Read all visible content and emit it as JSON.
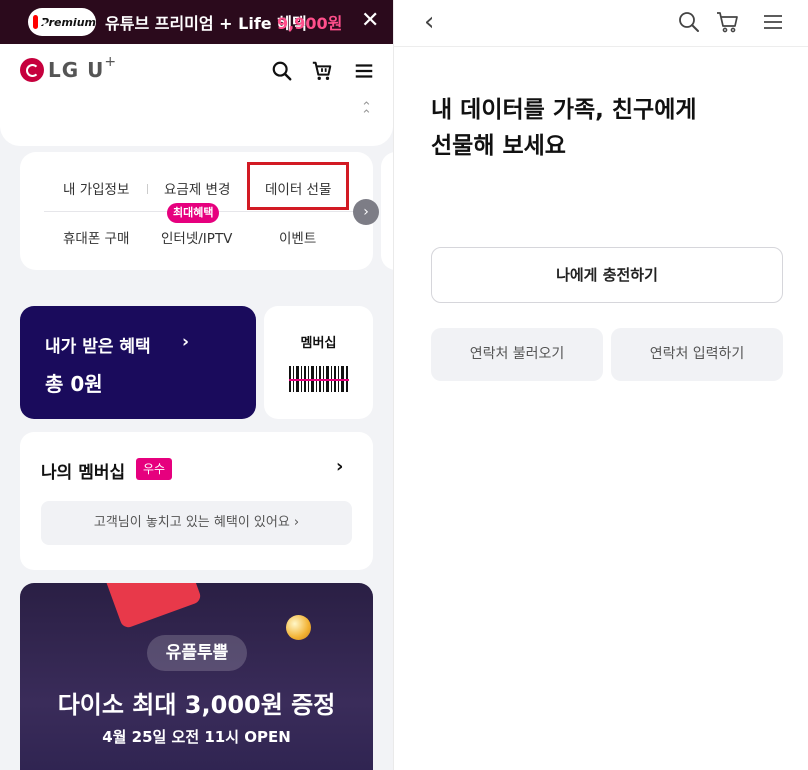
{
  "left": {
    "promo": {
      "badge_label": "Premium",
      "text": "유튜브 프리미엄 + Life 혜택",
      "price": "9,900원",
      "close_icon": "close-icon"
    },
    "header": {
      "logo_text": "LG U",
      "logo_plus": "+"
    },
    "menu": {
      "row1": [
        "내 가입정보",
        "요금제 변경",
        "데이터 선물"
      ],
      "row2": [
        "휴대폰 구매",
        "인터넷/IPTV",
        "이벤트"
      ],
      "badge": "최대혜택"
    },
    "benefit": {
      "title": "내가 받은 혜택",
      "arrow": "›",
      "total": "총 0원"
    },
    "membership": {
      "label": "멤버십"
    },
    "my_membership": {
      "title": "나의 멤버십",
      "grade": "우수",
      "info": "고객님이 놓치고 있는 혜택이 있어요 ›"
    },
    "event": {
      "pill": "유플투쁠",
      "title": "다이소 최대 3,000원 증정",
      "subtitle": "4월 25일 오전 11시 OPEN"
    }
  },
  "right": {
    "heading_line1": "내 데이터를 가족, 친구에게",
    "heading_line2": "선물해 보세요",
    "charge_button": "나에게 충전하기",
    "contact_load_button": "연락처 불러오기",
    "contact_input_button": "연락처 입력하기"
  },
  "colors": {
    "brand_magenta": "#e6007e",
    "benefit_navy": "#1a0b5c",
    "highlight_red": "#d21a23",
    "promo_bg": "#2b0a1c",
    "lg_red": "#c6003d"
  }
}
